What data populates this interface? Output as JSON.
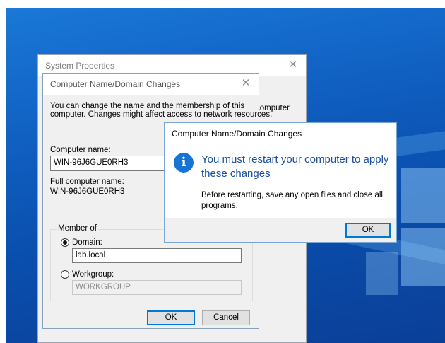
{
  "system_properties": {
    "title": "System Properties",
    "behind_text": "computer"
  },
  "name_dialog": {
    "title": "Computer Name/Domain Changes",
    "description_line1": "You can change the name and the membership of this",
    "description_line2": "computer. Changes might affect access to network resources.",
    "computer_name_label": "Computer name:",
    "computer_name_value": "WIN-96J6GUE0RH3",
    "full_name_label": "Full computer name:",
    "full_name_value": "WIN-96J6GUE0RH3",
    "member_of_label": "Member of",
    "domain_label": "Domain:",
    "domain_value": "lab.local",
    "domain_selected": true,
    "workgroup_label": "Workgroup:",
    "workgroup_value": "WORKGROUP",
    "ok_label": "OK",
    "cancel_label": "Cancel"
  },
  "message_box": {
    "title": "Computer Name/Domain Changes",
    "icon": "info-icon",
    "main_line1": "You must restart your computer to apply",
    "main_line2": "these changes",
    "body_line1": "Before restarting, save any open files and close all",
    "body_line2": "programs.",
    "ok_label": "OK"
  },
  "colors": {
    "desktop_blue": "#0f5ec0",
    "instruction_blue": "#1a4fa0",
    "accent": "#0078d7"
  }
}
